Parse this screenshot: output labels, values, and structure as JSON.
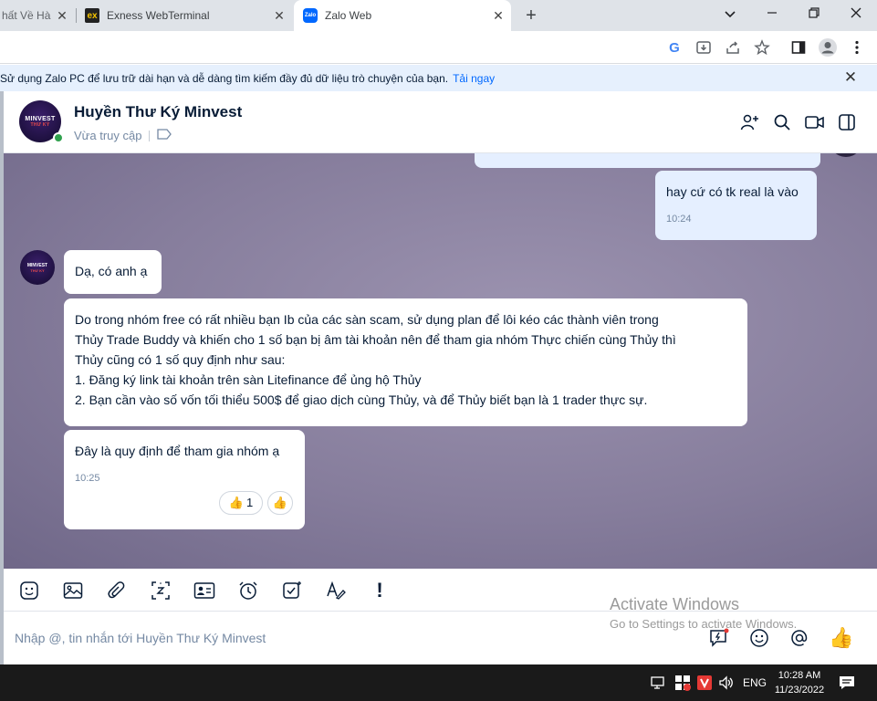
{
  "browser": {
    "tabs": [
      {
        "title": "hất Về Hà"
      },
      {
        "title": "Exness WebTerminal"
      },
      {
        "title": "Zalo Web",
        "favicon_text": "Zalo"
      }
    ],
    "new_tab": "+",
    "window_controls": {
      "minimize": "⌄",
      "restore": "—",
      "maximize": "❐",
      "close": "✕"
    }
  },
  "toolbar": {
    "icons": [
      "google-icon",
      "download-icon",
      "share-icon",
      "star-icon",
      "sidepanel-icon",
      "profile-icon",
      "menu-icon"
    ],
    "google_glyph": "G"
  },
  "banner": {
    "text": "Sử dụng Zalo PC để lưu trữ dài hạn và dễ dàng tìm kiếm đầy đủ dữ liệu trò chuyện của bạn.",
    "link": "Tải ngay",
    "close": "✕"
  },
  "chat": {
    "contact_name": "Huyền Thư Ký Minvest",
    "status": "Vừa truy cập",
    "avatar_text": "MINVEST",
    "avatar_sub": "THƯ KÝ"
  },
  "messages": [
    {
      "direction": "out",
      "text": "hay cứ có tk real là vào",
      "time": "10:24"
    },
    {
      "direction": "in",
      "text": "Dạ, có anh ạ"
    },
    {
      "direction": "in",
      "lines": [
        "Do trong nhóm free có rất nhiều bạn Ib của các sàn scam, sử dụng plan để lôi kéo các thành viên trong",
        "Thủy Trade Buddy và khiến cho 1 số bạn bị âm tài khoản nên để tham gia nhóm Thực chiến cùng Thủy thì",
        "Thủy cũng có 1 số quy định như sau:",
        "1. Đăng ký link tài khoản trên sàn Litefinance để ủng hộ Thủy",
        "2. Bạn cần vào số vốn tối thiểu 500$ để giao dịch cùng Thủy, và để Thủy biết bạn là 1 trader thực sự."
      ]
    },
    {
      "direction": "in",
      "text": "Đây là quy định để tham gia nhóm ạ",
      "time": "10:25",
      "reaction_count": "1"
    }
  ],
  "composer": {
    "tools": [
      "sticker-icon",
      "image-icon",
      "attachment-icon",
      "screenshot-icon",
      "contact-card-icon",
      "reminder-icon",
      "todo-icon",
      "format-icon",
      "urgent-icon"
    ],
    "urgent_glyph": "!",
    "placeholder": "Nhập @, tin nhắn tới Huyền Thư Ký Minvest"
  },
  "watermark": {
    "line1": "Activate Windows",
    "line2": "Go to Settings to activate Windows."
  },
  "taskbar": {
    "language": "ENG",
    "time": "10:28 AM",
    "date": "11/23/2022"
  },
  "colors": {
    "accent": "#0068ff",
    "bubble_out": "#e5efff",
    "online": "#30a14e",
    "chat_bg": "#867d9c"
  }
}
